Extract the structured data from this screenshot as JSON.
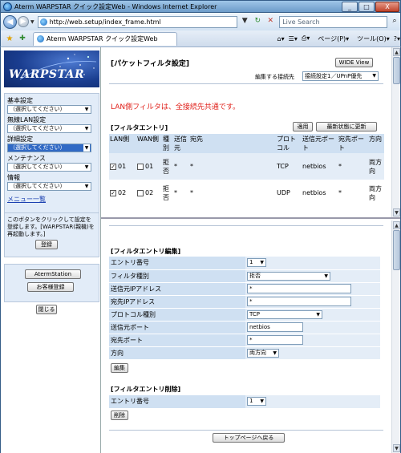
{
  "window": {
    "title": "Aterm WARPSTAR クイック設定Web - Windows Internet Explorer",
    "minimize": "_",
    "maximize": "□",
    "close": "X"
  },
  "address_bar": {
    "url": "http://web.setup/index_frame.html",
    "search_placeholder": "Live Search"
  },
  "tab_bar": {
    "tab_title": "Aterm WARPSTAR クイック設定Web",
    "page_menu": "ページ(P)",
    "tools_menu": "ツール(O)"
  },
  "sidebar": {
    "logo_text": "WARPSTAR",
    "groups": [
      {
        "label": "基本設定",
        "value": "（選択してください）"
      },
      {
        "label": "無線LAN設定",
        "value": "（選択してください）"
      },
      {
        "label": "詳細設定",
        "value": "（選択してください）"
      },
      {
        "label": "メンテナンス",
        "value": "（選択してください）"
      },
      {
        "label": "情報",
        "value": "（選択してください）"
      }
    ],
    "menu_list": "メニュー一覧",
    "note": "このボタンをクリックして設定を登録します。[WARPSTAR(親機)を再起動します。]",
    "register_button": "登録",
    "atermstation_button": "AtermStation",
    "customer_button": "お客様登録",
    "close_button": "閉じる"
  },
  "top": {
    "title": "[パケットフィルタ設定]",
    "wide_view": "WIDE View",
    "conn_label": "編集する接続先",
    "conn_value": "接続設定1／UPnP優先",
    "notice": "LAN側フィルタは、全接続先共通です。",
    "entry_section": "[フィルタエントリ]",
    "apply": "適用",
    "refresh": "最新状態に更新",
    "headers": [
      "LAN側",
      "WAN側",
      "種別",
      "送信元",
      "宛先",
      "プロトコル",
      "送信元ポート",
      "宛先ポート",
      "方向"
    ],
    "rows": [
      {
        "lan_checked": "✓",
        "lan": "01",
        "wan": "01",
        "type": "拒否",
        "src": "*",
        "dst": "*",
        "proto": "TCP",
        "src_port": "netbios",
        "dst_port": "*",
        "dir": "両方向"
      },
      {
        "lan_checked": "✓",
        "lan": "02",
        "wan": "02",
        "type": "拒否",
        "src": "*",
        "dst": "*",
        "proto": "UDP",
        "src_port": "netbios",
        "dst_port": "*",
        "dir": "両方向"
      }
    ]
  },
  "edit": {
    "section": "[フィルタエントリ編集]",
    "fields": {
      "entry_no": {
        "label": "エントリ番号",
        "value": "1"
      },
      "filter_type": {
        "label": "フィルタ種別",
        "value": "拒否"
      },
      "src_ip": {
        "label": "送信元IPアドレス",
        "value": "*"
      },
      "dst_ip": {
        "label": "宛先IPアドレス",
        "value": "*"
      },
      "protocol": {
        "label": "プロトコル種別",
        "value": "TCP"
      },
      "src_port": {
        "label": "送信元ポート",
        "value": "netbios"
      },
      "dst_port": {
        "label": "宛先ポート",
        "value": "*"
      },
      "direction": {
        "label": "方向",
        "value": "両方向"
      }
    },
    "edit_button": "編集"
  },
  "delete": {
    "section": "[フィルタエントリ削除]",
    "entry_label": "エントリ番号",
    "entry_value": "1",
    "delete_button": "削除"
  },
  "top_page_button": "トップページへ戻る"
}
